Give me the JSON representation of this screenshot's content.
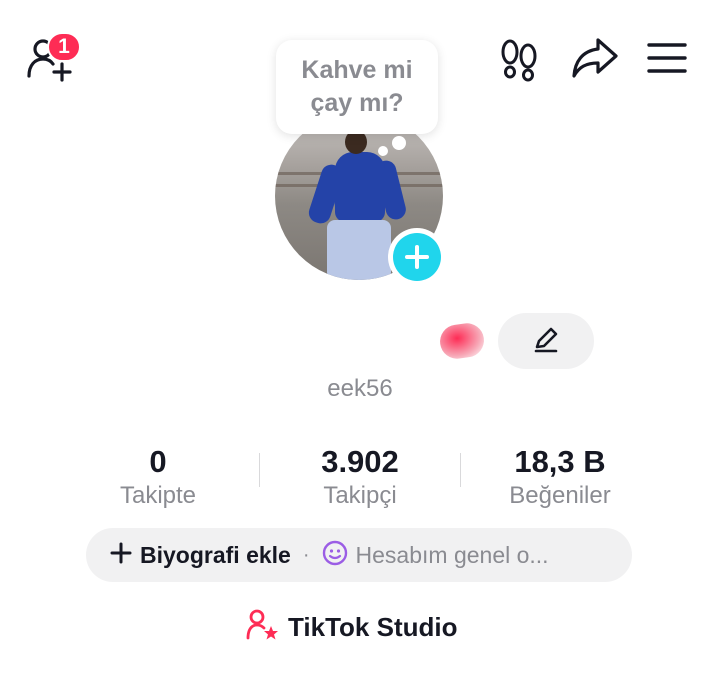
{
  "header": {
    "notification_count": "1"
  },
  "bubble": {
    "text_line1": "Kahve mi",
    "text_line2": "çay mı?"
  },
  "profile": {
    "username": "eek56"
  },
  "stats": [
    {
      "value": "0",
      "label": "Takipte"
    },
    {
      "value": "3.902",
      "label": "Takipçi"
    },
    {
      "value": "18,3 B",
      "label": "Beğeniler"
    }
  ],
  "bio": {
    "add_label": "Biyografi ekle",
    "separator": "·",
    "status_text": "Hesabım genel o..."
  },
  "studio": {
    "label": "TikTok Studio"
  },
  "colors": {
    "accent": "#fe2c55",
    "cyan": "#20d5ec",
    "muted_text": "#8a8b91",
    "pill_bg": "#f1f1f2",
    "status_purple": "#9b5de5"
  },
  "icons": [
    "add-friend-icon",
    "footprints-icon",
    "share-icon",
    "menu-icon",
    "plus-icon",
    "pencil-icon",
    "smiley-icon",
    "studio-person-star-icon"
  ]
}
